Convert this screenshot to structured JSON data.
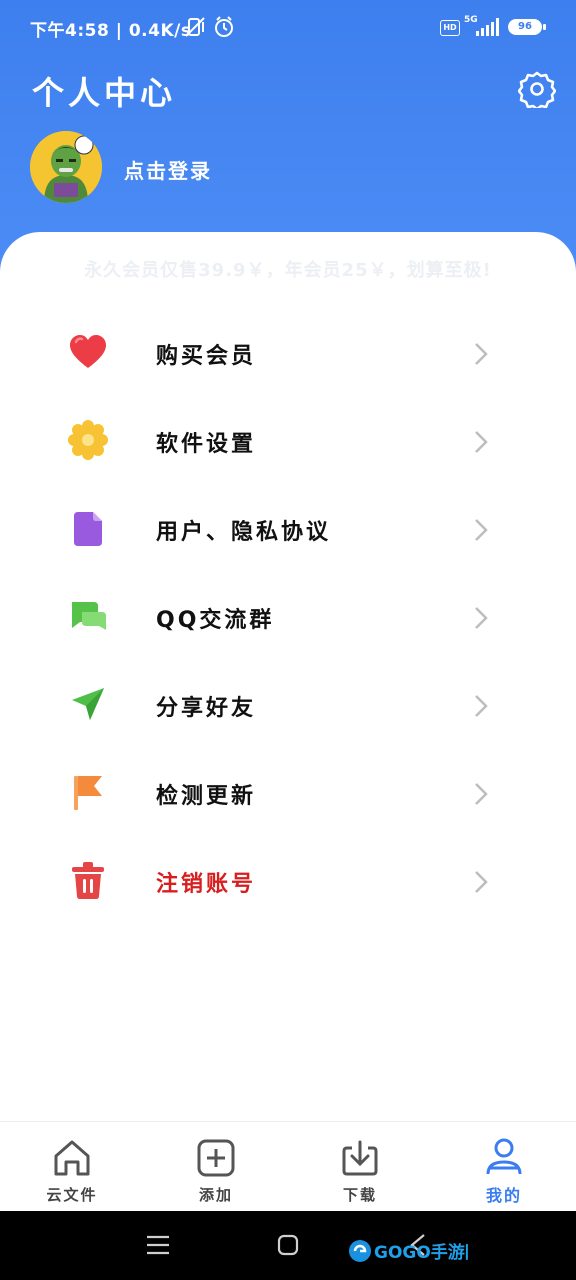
{
  "status_bar": {
    "time_speed": "下午4:58 | 0.4K/s",
    "hd": "HD",
    "network": "5G",
    "battery": "96"
  },
  "header": {
    "title": "个人中心",
    "login_text": "点击登录"
  },
  "promo": "永久会员仅售39.9￥，年会员25￥，划算至极!",
  "menu": {
    "items": [
      {
        "label": "购买会员",
        "icon": "heart-icon"
      },
      {
        "label": "软件设置",
        "icon": "settings-flower-icon"
      },
      {
        "label": "用户、隐私协议",
        "icon": "document-icon"
      },
      {
        "label": "QQ交流群",
        "icon": "chat-bubbles-icon"
      },
      {
        "label": "分享好友",
        "icon": "paper-plane-icon"
      },
      {
        "label": "检测更新",
        "icon": "flag-icon"
      },
      {
        "label": "注销账号",
        "icon": "trash-icon"
      }
    ]
  },
  "tabs": [
    {
      "label": "云文件",
      "icon": "home-icon"
    },
    {
      "label": "添加",
      "icon": "add-icon"
    },
    {
      "label": "下载",
      "icon": "download-icon"
    },
    {
      "label": "我的",
      "icon": "user-icon"
    }
  ],
  "colors": {
    "header_blue": "#3d7fee",
    "active_tab": "#3a7df0",
    "danger": "#d81e1e"
  },
  "watermark": "GOGO手游网"
}
